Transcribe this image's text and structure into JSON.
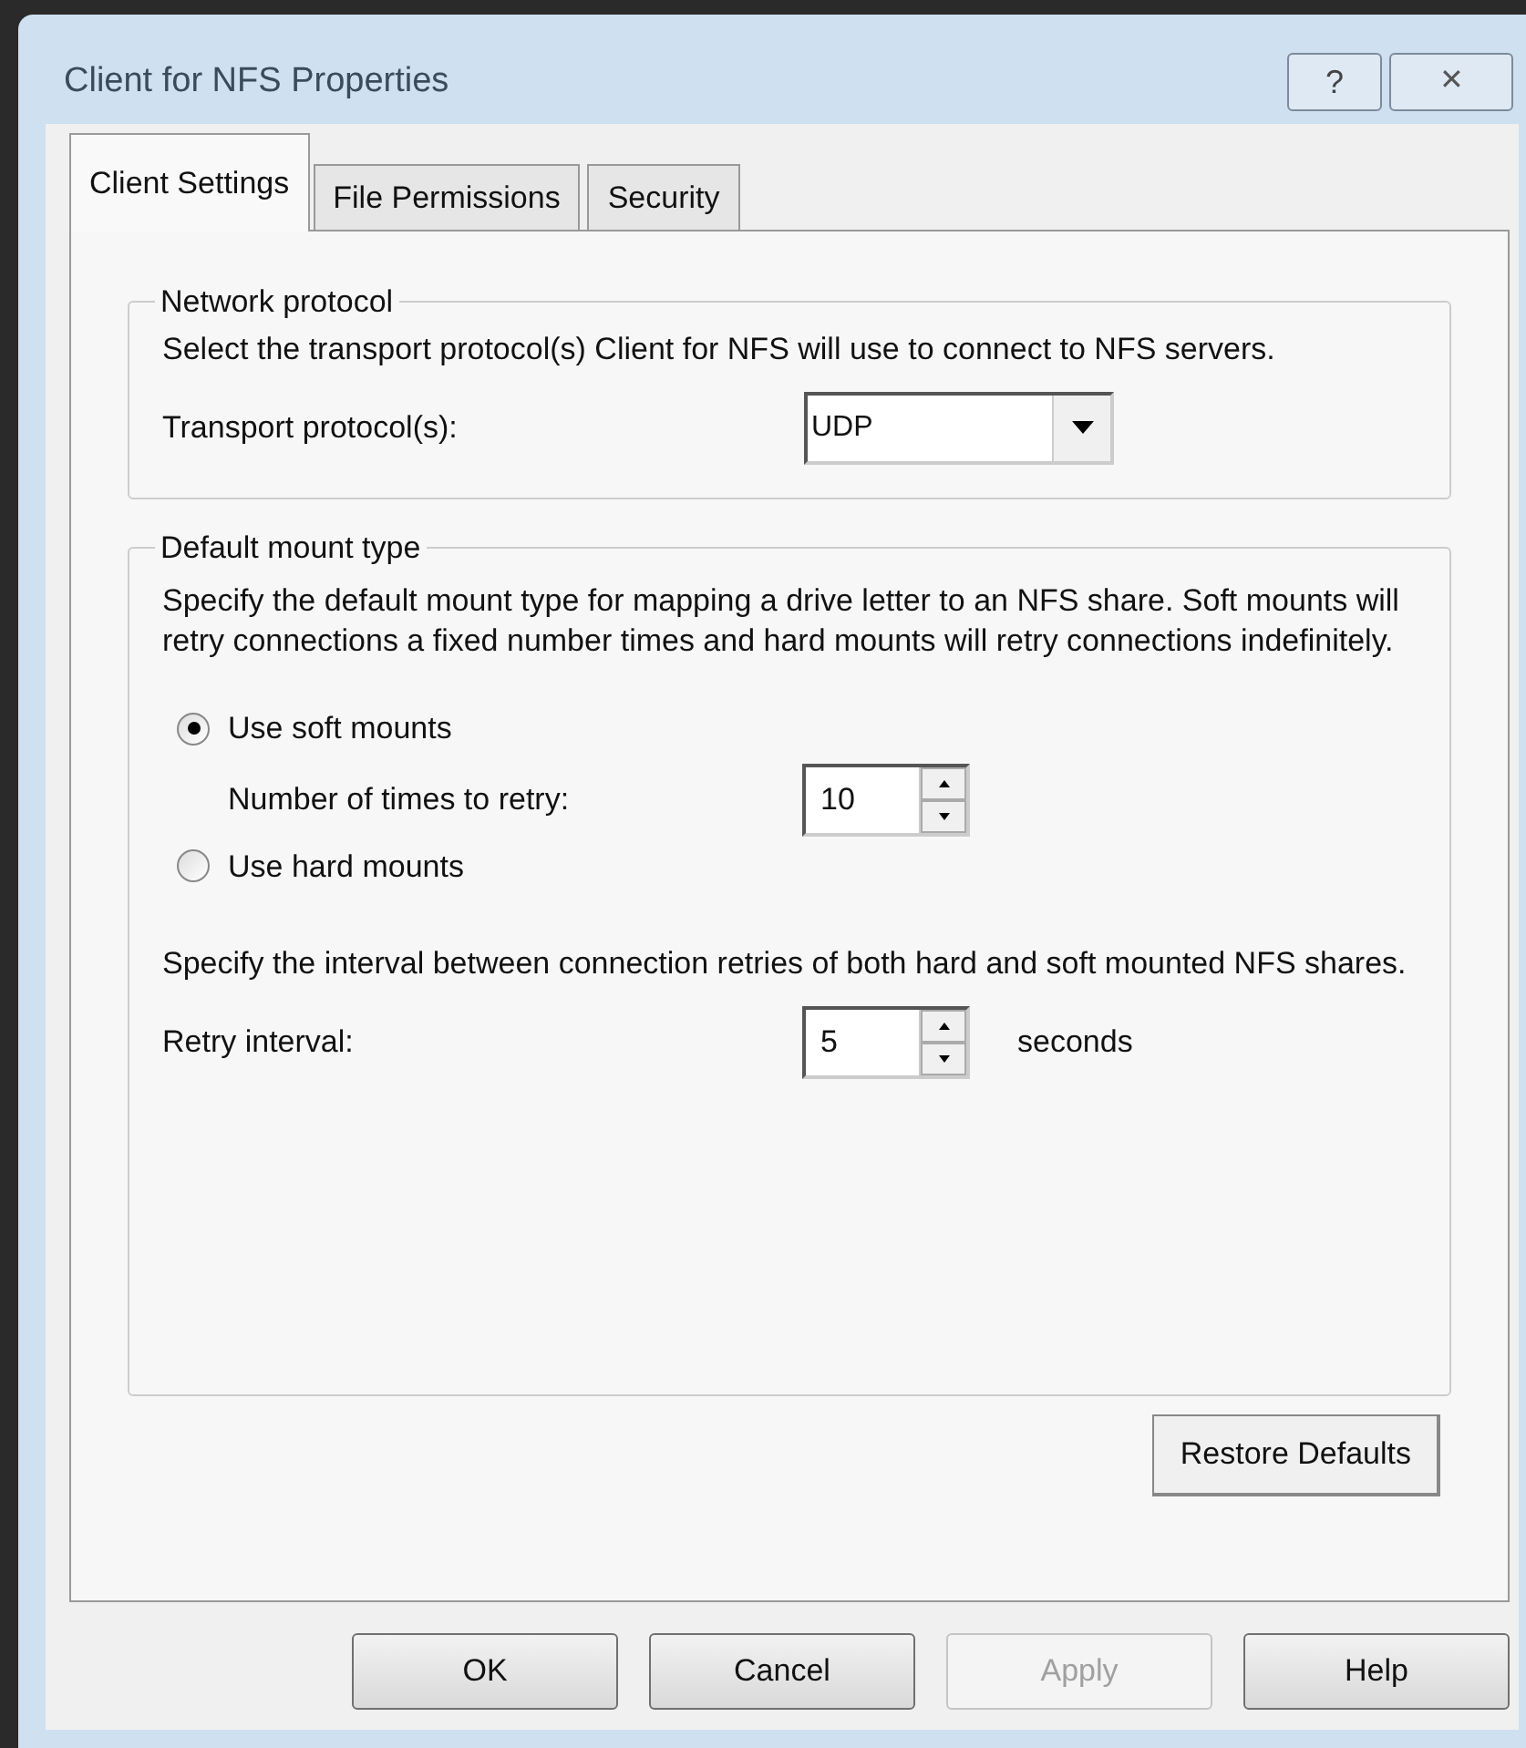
{
  "window": {
    "title": "Client for NFS Properties",
    "help_button": "?",
    "close_button": "✕"
  },
  "tabs": [
    {
      "label": "Client Settings",
      "selected": true
    },
    {
      "label": "File Permissions",
      "selected": false
    },
    {
      "label": "Security",
      "selected": false
    }
  ],
  "network_protocol": {
    "legend": "Network protocol",
    "description": "Select the transport protocol(s) Client for NFS will use to connect to NFS servers.",
    "transport_label": "Transport protocol(s):",
    "transport_value": "UDP"
  },
  "mount_type": {
    "legend": "Default mount type",
    "description": "Specify the default mount type for mapping a drive letter to an NFS share.  Soft mounts will retry connections a fixed number times and hard mounts will retry connections indefinitely.",
    "options": [
      {
        "label": "Use soft mounts",
        "selected": true
      },
      {
        "label": "Use hard mounts",
        "selected": false
      }
    ],
    "retry_label": "Number of times to retry:",
    "retry_value": "10",
    "interval_description": "Specify the interval between connection retries of both hard and soft mounted NFS shares.",
    "interval_label": "Retry interval:",
    "interval_value": "5",
    "interval_unit": "seconds"
  },
  "restore_button": "Restore Defaults",
  "buttons": [
    {
      "label": "OK",
      "disabled": false
    },
    {
      "label": "Cancel",
      "disabled": false
    },
    {
      "label": "Apply",
      "disabled": true
    },
    {
      "label": "Help",
      "disabled": false
    }
  ]
}
